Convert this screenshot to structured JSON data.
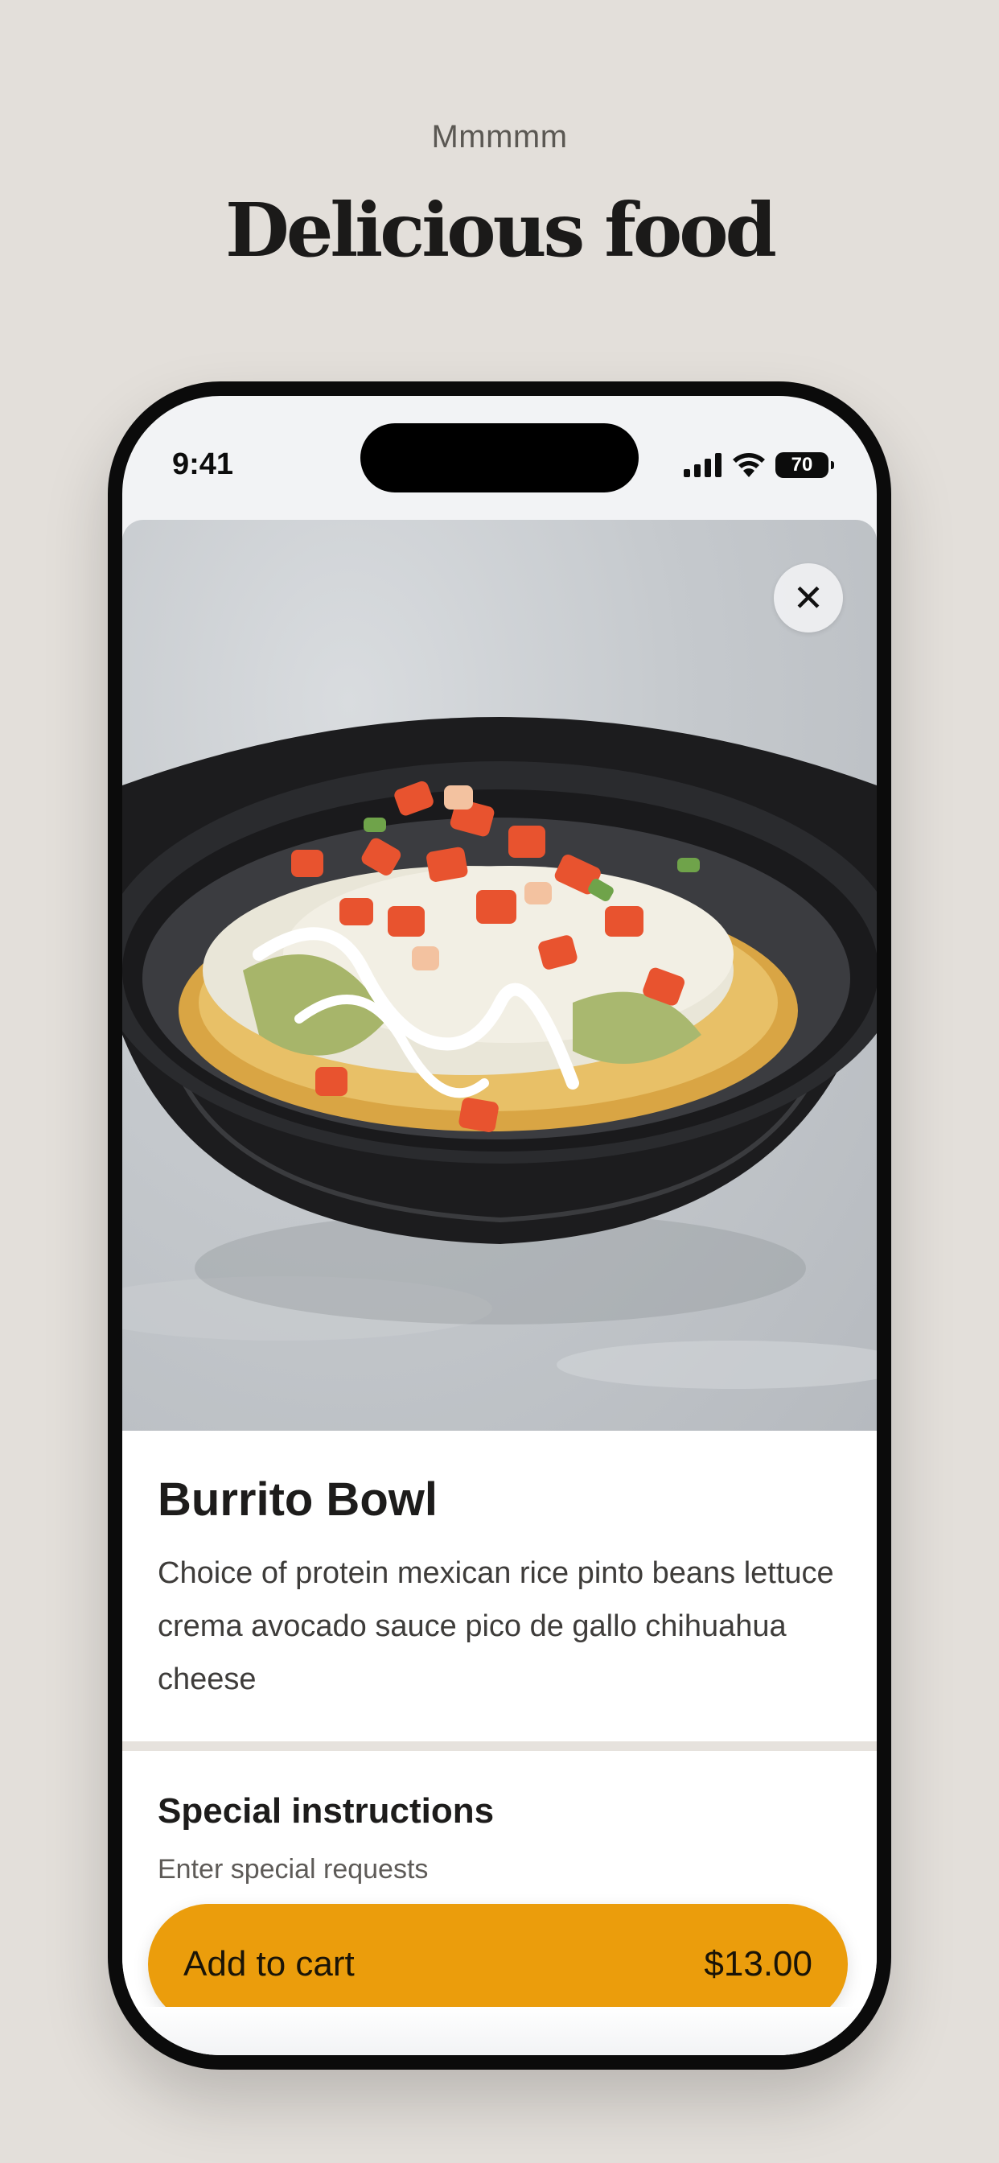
{
  "header": {
    "tagline": "Mmmmm",
    "headline": "Delicious food"
  },
  "status_bar": {
    "time": "9:41",
    "battery": "70",
    "icons": [
      "signal-icon",
      "wifi-icon",
      "battery-icon"
    ]
  },
  "product": {
    "photo_alt": "Burrito Bowl",
    "title": "Burrito Bowl",
    "description": "Choice of protein mexican rice pinto beans lettuce crema avocado sauce pico de gallo chihuahua cheese"
  },
  "instructions": {
    "title": "Special instructions",
    "placeholder": "Enter special requests"
  },
  "cart_button": {
    "label": "Add to cart",
    "price": "$13.00"
  },
  "colors": {
    "background": "#e3dfda",
    "accent": "#eb9d0c",
    "text": "#1d1c1b"
  }
}
